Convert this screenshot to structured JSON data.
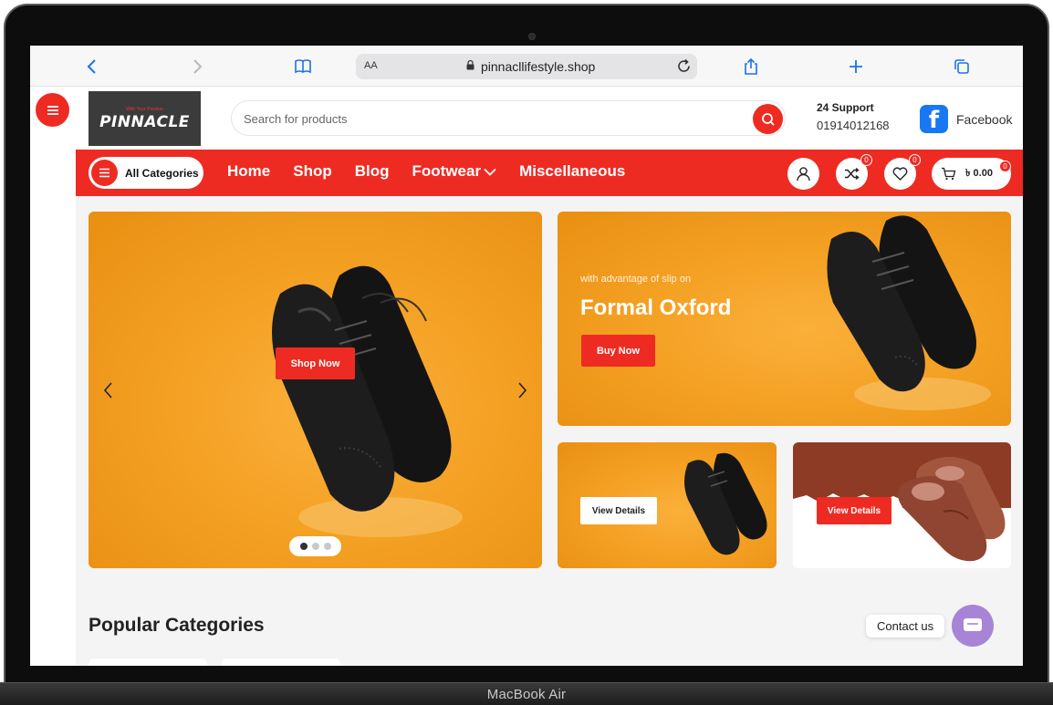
{
  "device": {
    "label": "MacBook Air"
  },
  "browser": {
    "aa_label": "AA",
    "url": "pinnacllifestyle.shop"
  },
  "header": {
    "logo_text": "PINNACLE",
    "logo_tagline": "With Your Passion",
    "search_placeholder": "Search for products",
    "support_title": "24 Support",
    "support_phone": "01914012168",
    "facebook_label": "Facebook"
  },
  "nav": {
    "all_categories": "All Categories",
    "links": [
      "Home",
      "Shop",
      "Blog",
      "Footwear",
      "Miscellaneous"
    ],
    "compare_count": "0",
    "wishlist_count": "0",
    "cart_count": "0",
    "cart_amount": "৳ 0.00"
  },
  "hero": {
    "main_button": "Shop Now",
    "slide_count": 3,
    "active_slide": 1
  },
  "promo_top": {
    "eyebrow": "with advantage of slip on",
    "title": "Formal Oxford",
    "button": "Buy Now"
  },
  "promo_small_left": {
    "button": "View Details"
  },
  "promo_small_right": {
    "button": "View Details"
  },
  "sections": {
    "popular_categories": "Popular Categories"
  },
  "contact": {
    "label": "Contact us"
  },
  "colors": {
    "brand_red": "#ee2b22",
    "banner_orange": "#f4a124",
    "chat_purple": "#a884d6"
  }
}
